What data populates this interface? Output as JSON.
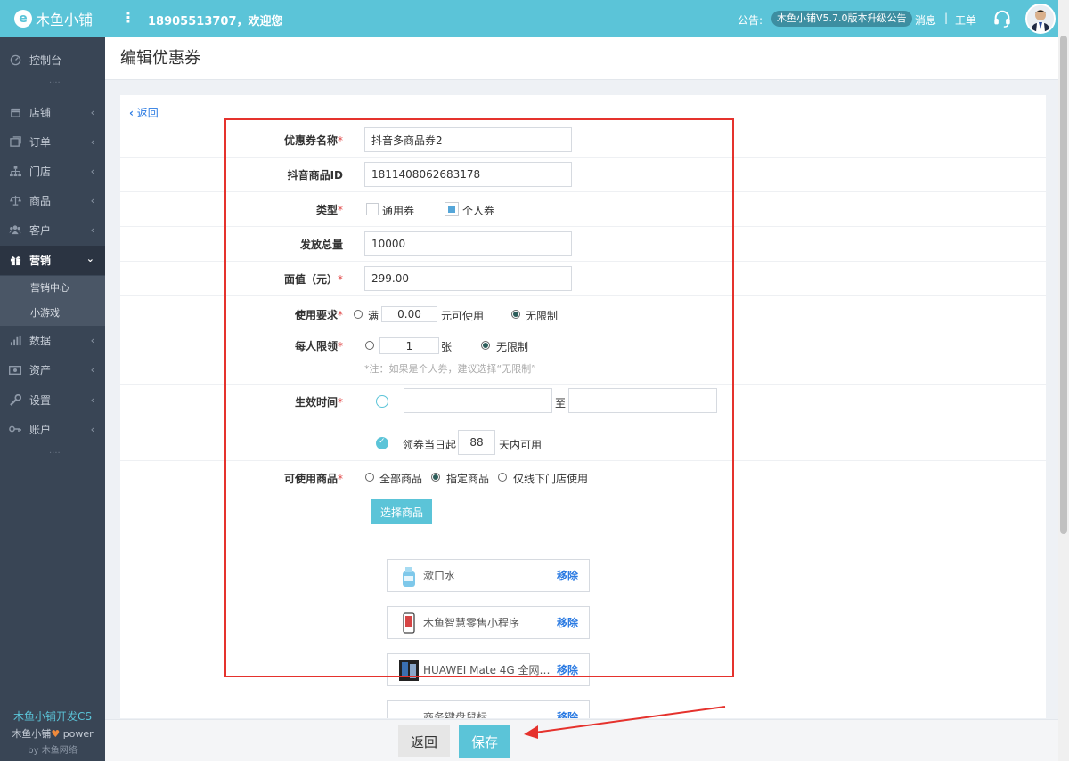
{
  "topbar": {
    "logo_letter": "e",
    "logo_text": "木鱼小铺",
    "menu_icon": "⋮",
    "welcome": "18905513707，欢迎您",
    "notice_label": "公告:",
    "notice_text": "木鱼小铺V5.7.0版本升级公告",
    "messages": "消息",
    "separator": "|",
    "tickets": "工单"
  },
  "sidebar": {
    "items": [
      {
        "label": "控制台",
        "icon": "dashboard-icon"
      },
      {
        "label": "店铺",
        "icon": "store-icon"
      },
      {
        "label": "订单",
        "icon": "order-icon"
      },
      {
        "label": "门店",
        "icon": "branch-icon"
      },
      {
        "label": "商品",
        "icon": "scale-icon"
      },
      {
        "label": "客户",
        "icon": "users-icon"
      },
      {
        "label": "营销",
        "icon": "gift-icon"
      },
      {
        "label": "数据",
        "icon": "chart-icon"
      },
      {
        "label": "资产",
        "icon": "money-icon"
      },
      {
        "label": "设置",
        "icon": "wrench-icon"
      },
      {
        "label": "账户",
        "icon": "key-icon"
      }
    ],
    "sub_items": [
      "营销中心",
      "小游戏"
    ],
    "footer_title": "木鱼小铺开发CS",
    "footer_line": "木鱼小铺",
    "footer_power": "power",
    "footer_by": "by 木鱼网络"
  },
  "page": {
    "title": "编辑优惠券",
    "back": "返回"
  },
  "form": {
    "name_label": "优惠券名称",
    "name_value": "抖音多商品券2",
    "douyin_id_label": "抖音商品ID",
    "douyin_id_value": "1811408062683178",
    "type_label": "类型",
    "type_general": "通用券",
    "type_personal": "个人券",
    "total_label": "发放总量",
    "total_value": "10000",
    "face_label": "面值（元）",
    "face_value": "299.00",
    "use_label": "使用要求",
    "use_full": "满",
    "use_amount": "0.00",
    "use_suffix": "元可使用",
    "use_unlimited": "无限制",
    "limit_label": "每人限领",
    "limit_value": "1",
    "limit_unit": "张",
    "limit_unlimited": "无限制",
    "limit_hint": "*注：如果是个人券，建议选择“无限制”",
    "valid_label": "生效时间",
    "valid_to": "至",
    "valid_days_prefix": "领券当日起",
    "valid_days": "88",
    "valid_days_suffix": "天内可用",
    "goods_label": "可使用商品",
    "goods_all": "全部商品",
    "goods_specified": "指定商品",
    "goods_offline": "仅线下门店使用",
    "select_goods": "选择商品",
    "required_mark": "*"
  },
  "goods_list": [
    {
      "name": "漱口水",
      "remove": "移除"
    },
    {
      "name": "木鱼智慧零售小程序",
      "remove": "移除"
    },
    {
      "name": "HUAWEI Mate 4G 全网通 ...",
      "remove": "移除"
    },
    {
      "name": "商务键盘鼠标",
      "remove": "移除"
    }
  ],
  "footer": {
    "back": "返回",
    "save": "保存"
  },
  "colors": {
    "accent": "#5bc4d8",
    "sidebar": "#394555",
    "highlight_box": "#e5322d",
    "link": "#2a7ae2"
  }
}
